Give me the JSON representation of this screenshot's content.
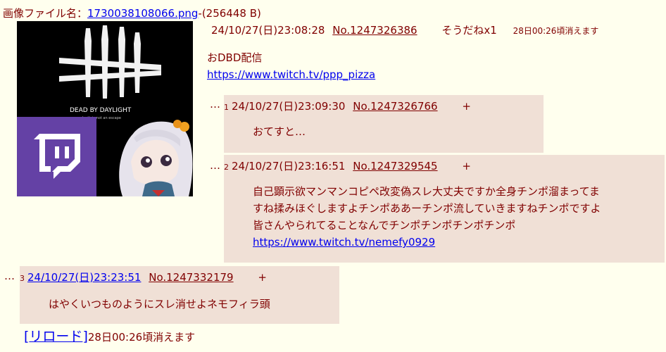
{
  "file": {
    "label": "画像ファイル名：",
    "name": "1730038108066.png",
    "size": "-(256448 B)"
  },
  "thumb": {
    "game_title": "DEAD BY DAYLIGHT",
    "game_tagline": "death is not an escape"
  },
  "op": {
    "date": "24/10/27(日)23:08:28",
    "no": "No.1247326386",
    "sodane": "そうだねx1",
    "expire": "28日00:26頃消えます",
    "line1": "おDBD配信",
    "link": "https://www.twitch.tv/ppp_pizza"
  },
  "replies": [
    {
      "dots": "…",
      "num": "1",
      "date": "24/10/27(日)23:09:30",
      "no": "No.1247326766",
      "plus": "+",
      "lines": [
        "おてすと…"
      ]
    },
    {
      "dots": "…",
      "num": "2",
      "date": "24/10/27(日)23:16:51",
      "no": "No.1247329545",
      "plus": "+",
      "lines": [
        "自己顕示欲マンマンコピペ改変偽スレ大丈夫ですか全身チンポ溜まってま",
        "すね揉みほぐしますよチンポああーチンポ流していきますねチンポですよ",
        "皆さんやられてることなんでチンポチンポチンポチンポ"
      ],
      "link": "https://www.twitch.tv/nemefy0929"
    },
    {
      "dots": "…",
      "num": "3",
      "date": "24/10/27(日)23:23:51",
      "no": "No.1247332179",
      "plus": "+",
      "lines": [
        "はやくいつものようにスレ消せよネモフィラ頭"
      ]
    }
  ],
  "footer": {
    "open": "[",
    "reload": "リロード",
    "close": "]",
    "expire": "28日00:26頃消えます"
  },
  "colors": {
    "background": "#ffffee",
    "reply_bg": "#f0e0d6",
    "text": "#800000",
    "link": "#0000ee",
    "twitch": "#6441a5"
  }
}
